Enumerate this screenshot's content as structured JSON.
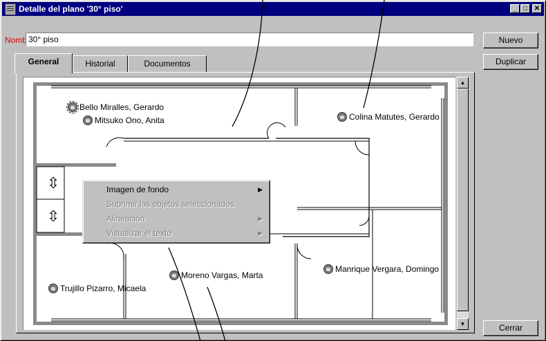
{
  "window": {
    "title": "Detalle del plano '30° piso'"
  },
  "title_buttons": {
    "minimize": "_",
    "maximize": "□",
    "close": "✕"
  },
  "name_field": {
    "label": "Nombre:",
    "value": "30° piso"
  },
  "buttons": {
    "nuevo": "Nuevo",
    "duplicar": "Duplicar",
    "cerrar": "Cerrar"
  },
  "tabs": [
    {
      "label": "General",
      "active": true
    },
    {
      "label": "Historial",
      "active": false
    },
    {
      "label": "Documentos",
      "active": false
    }
  ],
  "floorplan": {
    "people": [
      {
        "name": "Bello Miralles, Gerardo",
        "selected": true
      },
      {
        "name": "Mitsuko Ono, Anita"
      },
      {
        "name": "Colina Matutes, Gerardo"
      },
      {
        "name": "Manrique Vergara, Domingo"
      },
      {
        "name": "Moreno Vargas, Marta"
      },
      {
        "name": "Trujillo Pizarro, Micaela"
      }
    ]
  },
  "context_menu": {
    "items": [
      {
        "label": "Imagen de fondo",
        "enabled": true,
        "submenu": true
      },
      {
        "label": "Suprimir los objetos seleccionados",
        "enabled": false,
        "submenu": false
      },
      {
        "label": "Alineación",
        "enabled": false,
        "submenu": true
      },
      {
        "label": "Visualizar el texto",
        "enabled": false,
        "submenu": true
      }
    ]
  },
  "scrollbar": {
    "up": "▲",
    "down": "▼"
  }
}
